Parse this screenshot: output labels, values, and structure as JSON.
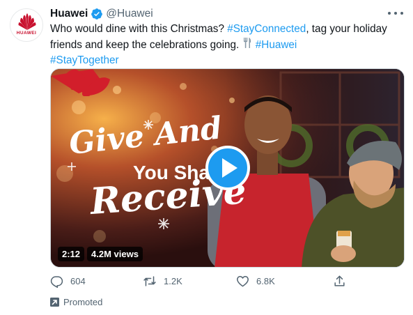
{
  "author": {
    "name": "Huawei",
    "handle": "@Huawei",
    "logo_text": "HUAWEI",
    "verified": true,
    "brand_color": "#c8102e"
  },
  "tweet": {
    "text_1": "Who would dine with this Christmas? ",
    "tag_stayconnected": "#StayConnected",
    "text_2": ", tag your holiday friends and keep the celebrations going. ",
    "emoji": "🍴",
    "tag_huawei": "#Huawei",
    "tag_staytogether": "#StayTogether",
    "link_color": "#1d9bf0"
  },
  "media": {
    "title_line_1": "Give And",
    "title_line_2": "You Sha",
    "title_line_3": "Receive",
    "duration": "2:12",
    "views": "4.2M views"
  },
  "actions": {
    "reply_count": "604",
    "retweet_count": "1.2K",
    "like_count": "6.8K"
  },
  "promoted_label": "Promoted",
  "icons": [
    "more-icon",
    "verified-icon",
    "play-icon",
    "reply-icon",
    "retweet-icon",
    "like-icon",
    "share-icon",
    "promoted-icon"
  ]
}
